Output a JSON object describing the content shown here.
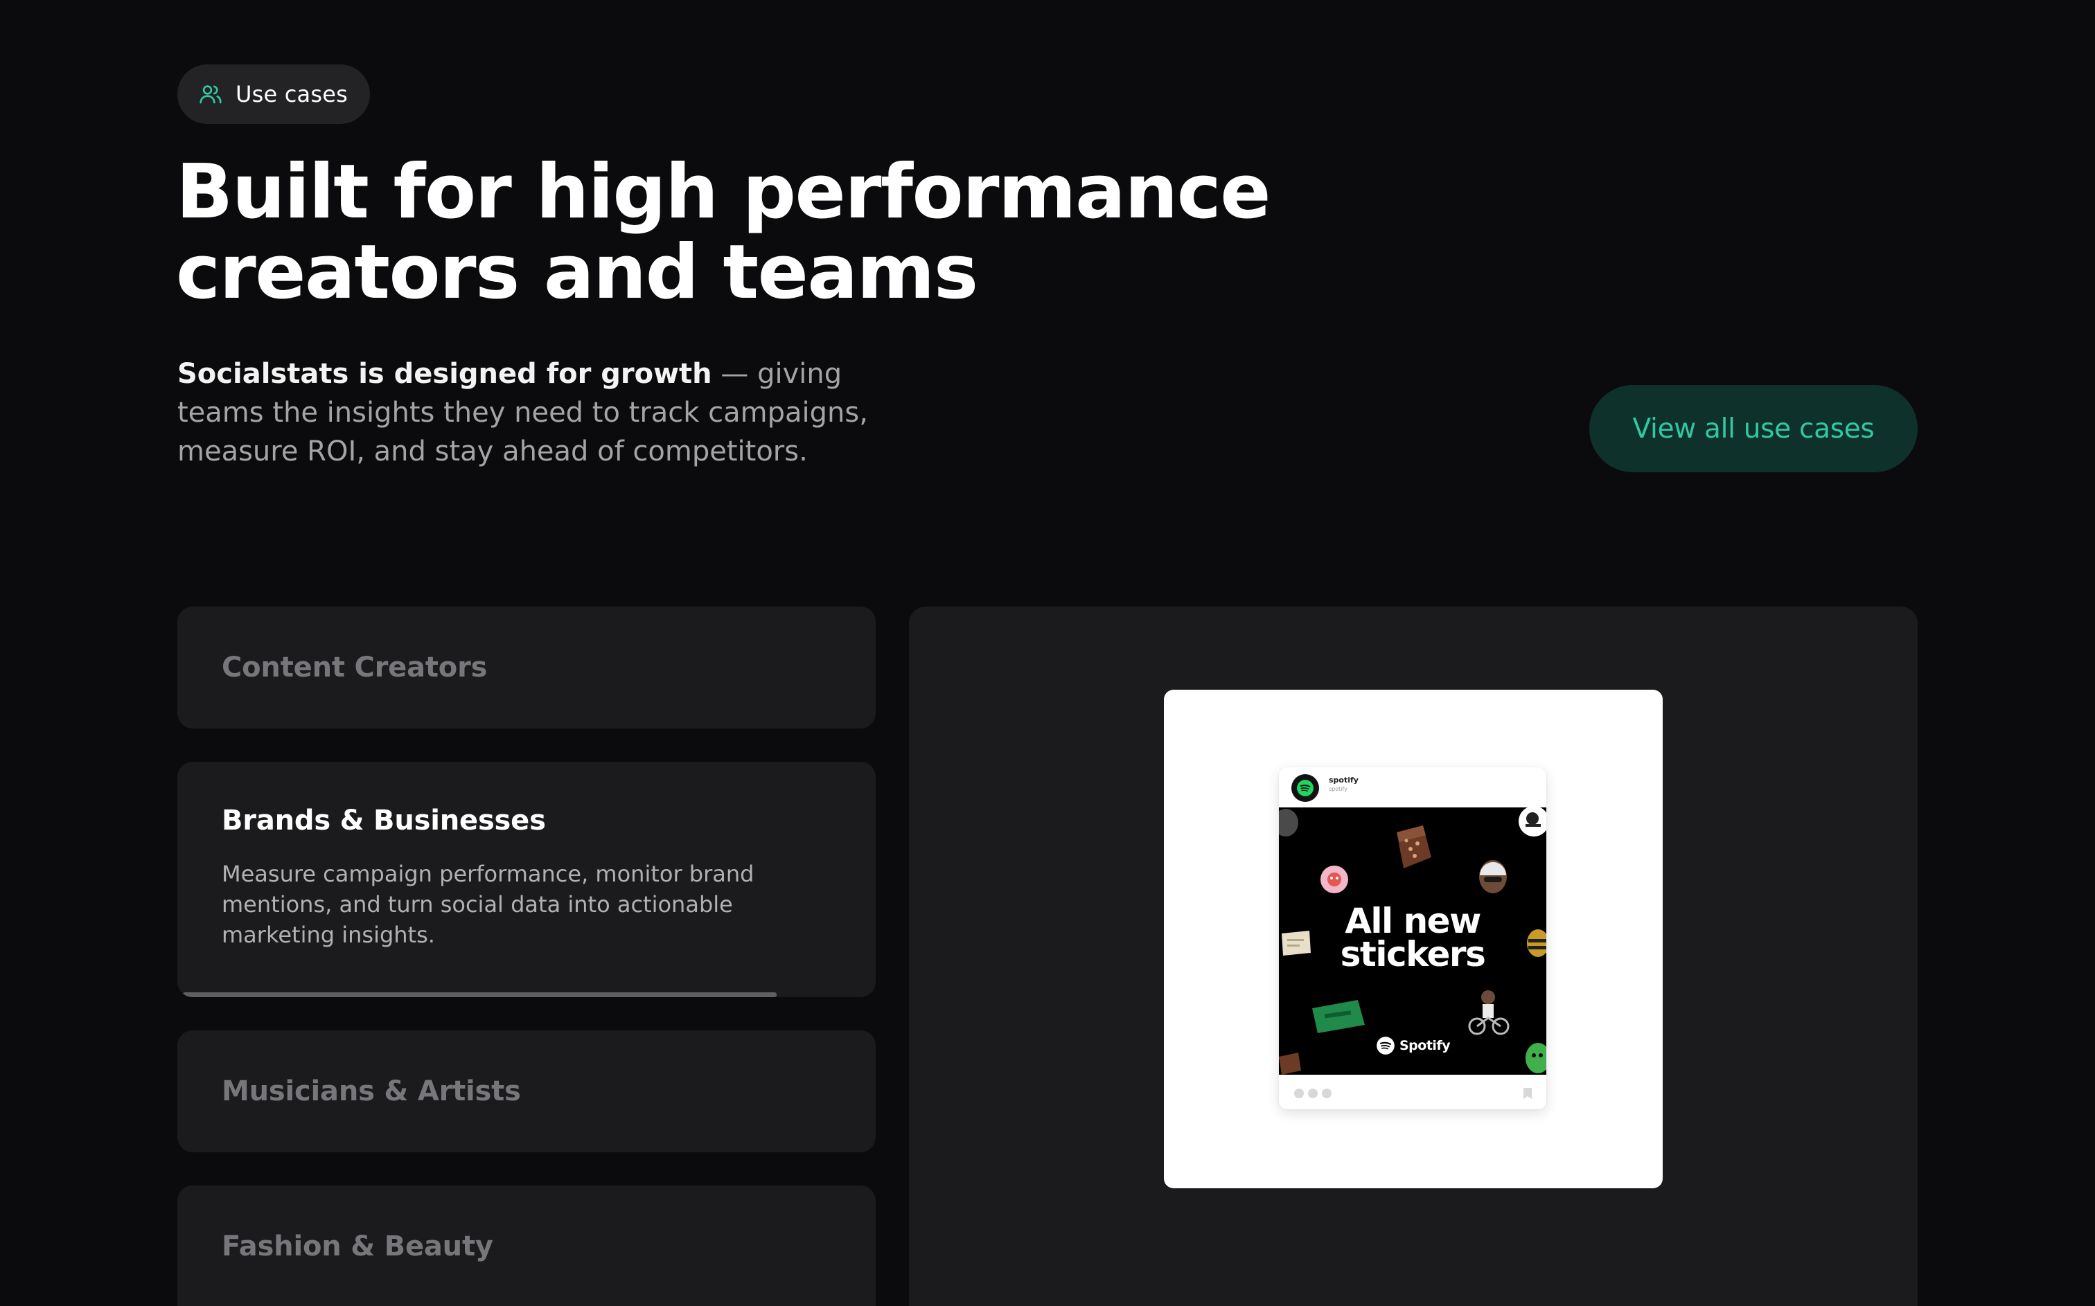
{
  "badge": {
    "icon": "users-icon",
    "label": "Use cases"
  },
  "headline": {
    "line1": "Built for high performance",
    "line2": "creators and teams"
  },
  "intro": {
    "bold": "Socialstats is designed for growth",
    "rest": " — giving teams the insights they need to track campaigns, measure ROI, and stay ahead of competitors."
  },
  "cta": {
    "label": "View all use cases"
  },
  "use_cases": {
    "items": [
      {
        "title": "Content Creators"
      },
      {
        "title": "Brands & Businesses",
        "description": "Measure campaign performance, monitor brand mentions, and turn social data into actionable marketing insights.",
        "progress_percent": 85
      },
      {
        "title": "Musicians & Artists"
      },
      {
        "title": "Fashion & Beauty"
      }
    ]
  },
  "preview": {
    "post": {
      "handle": "spotify",
      "subhandle": "spotify",
      "headline_line1": "All new",
      "headline_line2": "stickers",
      "brand": "Spotify"
    }
  },
  "colors": {
    "background": "#0b0b0d",
    "surface": "#1b1b1d",
    "accent": "#33c7a3",
    "cta_background": "#0e312c",
    "muted_text": "#77777b"
  }
}
